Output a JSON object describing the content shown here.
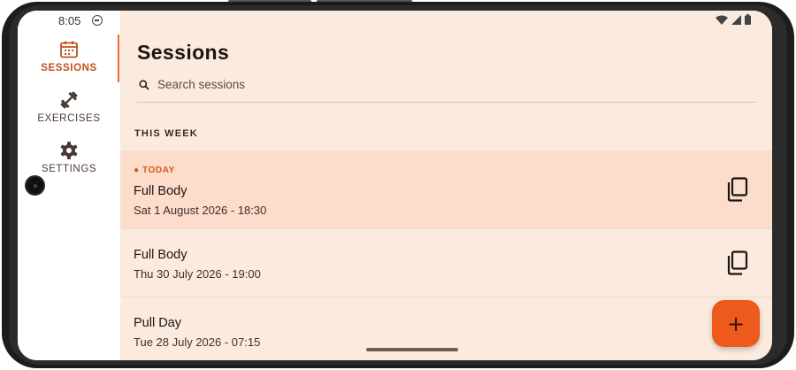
{
  "status_bar": {
    "time": "8:05"
  },
  "nav": {
    "items": [
      {
        "label": "SESSIONS",
        "icon": "calendar-icon",
        "active": true
      },
      {
        "label": "EXERCISES",
        "icon": "dumbbell-icon",
        "active": false
      },
      {
        "label": "SETTINGS",
        "icon": "gear-icon",
        "active": false
      }
    ]
  },
  "header": {
    "title": "Sessions"
  },
  "search": {
    "placeholder": "Search sessions"
  },
  "section": {
    "label": "THIS WEEK"
  },
  "sessions": [
    {
      "badge": "● TODAY",
      "name": "Full Body",
      "date": "Sat 1 August 2026 - 18:30",
      "highlighted": true
    },
    {
      "badge": "",
      "name": "Full Body",
      "date": "Thu 30 July 2026 - 19:00",
      "highlighted": false
    },
    {
      "badge": "",
      "name": "Pull Day",
      "date": "Tue 28 July 2026 - 07:15",
      "highlighted": false
    }
  ],
  "fab": {
    "label": "+"
  },
  "colors": {
    "accent": "#ee5a1c",
    "active_nav": "#c1501d",
    "background": "#fbebde",
    "highlight_row": "#fcdccb"
  }
}
